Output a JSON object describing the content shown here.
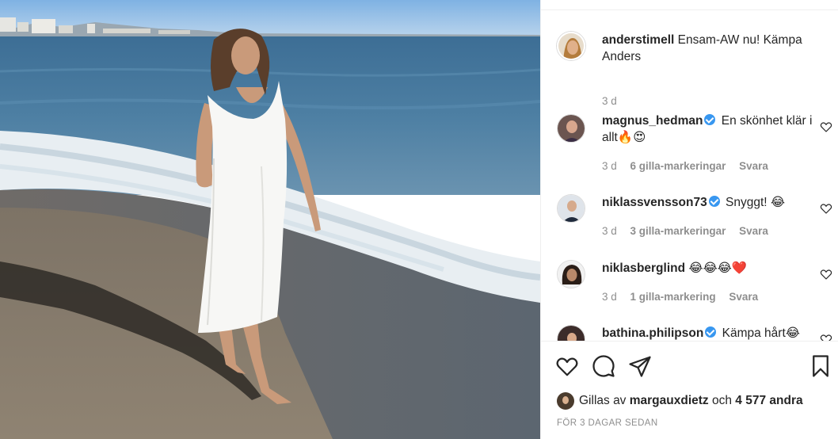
{
  "post": {
    "author": "anderstimell",
    "caption": "Ensam-AW nu! Kämpa Anders",
    "time": "3 d"
  },
  "comments": [
    {
      "username": "magnus_hedman",
      "verified": true,
      "text": "En skönhet klär i allt🔥😍",
      "time": "3 d",
      "likes": "6 gilla-markeringar",
      "reply": "Svara"
    },
    {
      "username": "niklassvensson73",
      "verified": true,
      "text": "Snyggt! 😂",
      "time": "3 d",
      "likes": "3 gilla-markeringar",
      "reply": "Svara"
    },
    {
      "username": "niklasberglind",
      "verified": false,
      "text": "😂😂😂❤️",
      "time": "3 d",
      "likes": "1 gilla-markering",
      "reply": "Svara"
    },
    {
      "username": "bathina.philipson",
      "verified": true,
      "text": "Kämpa hårt😂"
    }
  ],
  "likes_summary": {
    "prefix": "Gillas av",
    "user": "margauxdietz",
    "conjunction": "och",
    "count": "4 577 andra"
  },
  "post_date": "FÖR 3 DAGAR SEDAN",
  "icons": {
    "like": "heart-icon",
    "comment": "comment-icon",
    "share": "share-icon",
    "save": "bookmark-icon"
  },
  "colors": {
    "verified": "#3897f0",
    "muted": "#8e8e8e",
    "text": "#262626"
  }
}
